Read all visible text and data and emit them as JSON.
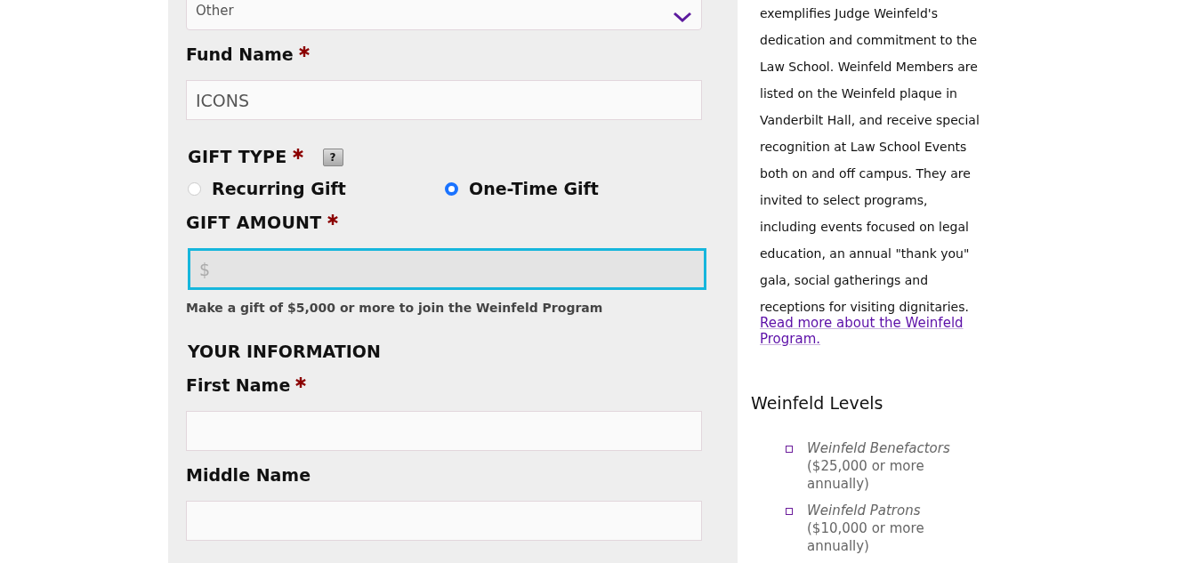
{
  "fund_select": {
    "value": "Other"
  },
  "fund_name": {
    "label": "Fund Name",
    "required": true,
    "value": "ICONS"
  },
  "gift_type": {
    "label": "GIFT TYPE",
    "required": true,
    "help": "?",
    "options": [
      {
        "label": "Recurring Gift",
        "selected": false
      },
      {
        "label": "One-Time Gift",
        "selected": true
      }
    ]
  },
  "gift_amount": {
    "label": "GIFT AMOUNT",
    "required": true,
    "placeholder": "$",
    "focused": true,
    "note": "Make a gift of $5,000 or more to join the Weinfeld Program"
  },
  "your_information": {
    "heading": "YOUR INFORMATION",
    "fields": [
      {
        "label": "First Name",
        "required": true
      },
      {
        "label": "Middle Name",
        "required": false
      }
    ]
  },
  "sidebar": {
    "paragraph": "exemplifies Judge Weinfeld's dedication and commitment to the Law School. Weinfeld Members are listed on the Weinfeld plaque in Vanderbilt Hall, and receive special recognition at Law School Events both on and off campus. They are invited to select programs, including events focused on legal education, an annual \"thank you\" gala, social gatherings and receptions for visiting dignitaries.",
    "link": "Read more about the Weinfeld Program.",
    "levels_heading": "Weinfeld Levels",
    "levels": [
      "*Weinfeld Benefactors* ($25,000 or more annually)",
      "*Weinfeld Patrons* ($10,000 or more annually)"
    ]
  }
}
